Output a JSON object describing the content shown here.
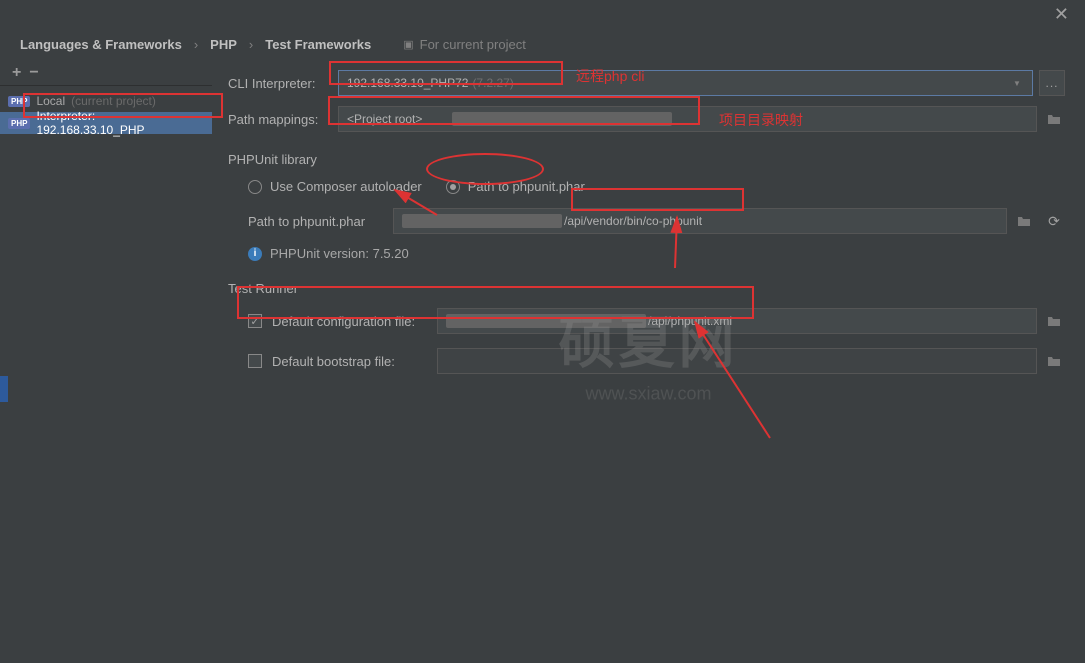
{
  "titlebar": {
    "close": "✕"
  },
  "breadcrumb": {
    "item1": "Languages & Frameworks",
    "item2": "PHP",
    "item3": "Test Frameworks",
    "sep": "›",
    "project_hint": "For current project"
  },
  "sidebar": {
    "add": "+",
    "remove": "−",
    "items": [
      {
        "badge": "PHP",
        "label": "Local",
        "hint": "(current project)"
      },
      {
        "badge": "PHP",
        "label": "Interpreter: 192.168.33.10_PHP"
      }
    ]
  },
  "main": {
    "cli_label": "CLI Interpreter:",
    "cli_value": "192.168.33.10_PHP72",
    "cli_version": "(7.2.27)",
    "browse": "...",
    "mappings_label": "Path mappings:",
    "mappings_value": "<Project root>",
    "phpunit_lib_title": "PHPUnit library",
    "radio_composer": "Use Composer autoloader",
    "radio_phar": "Path to phpunit.phar",
    "phar_path_label": "Path to phpunit.phar",
    "phar_path_suffix": "/api/vendor/bin/co-phpunit",
    "info_label": "PHPUnit version: 7.5.20",
    "test_runner_title": "Test Runner",
    "default_conf_label": "Default configuration file:",
    "default_conf_suffix": "/api/phpunit.xml",
    "default_boot_label": "Default bootstrap file:"
  },
  "annotations": {
    "remote_cli": "远程php cli",
    "dir_mapping": "项目目录映射"
  },
  "watermark": {
    "big": "硕夏网",
    "small": "www.sxiaw.com"
  }
}
